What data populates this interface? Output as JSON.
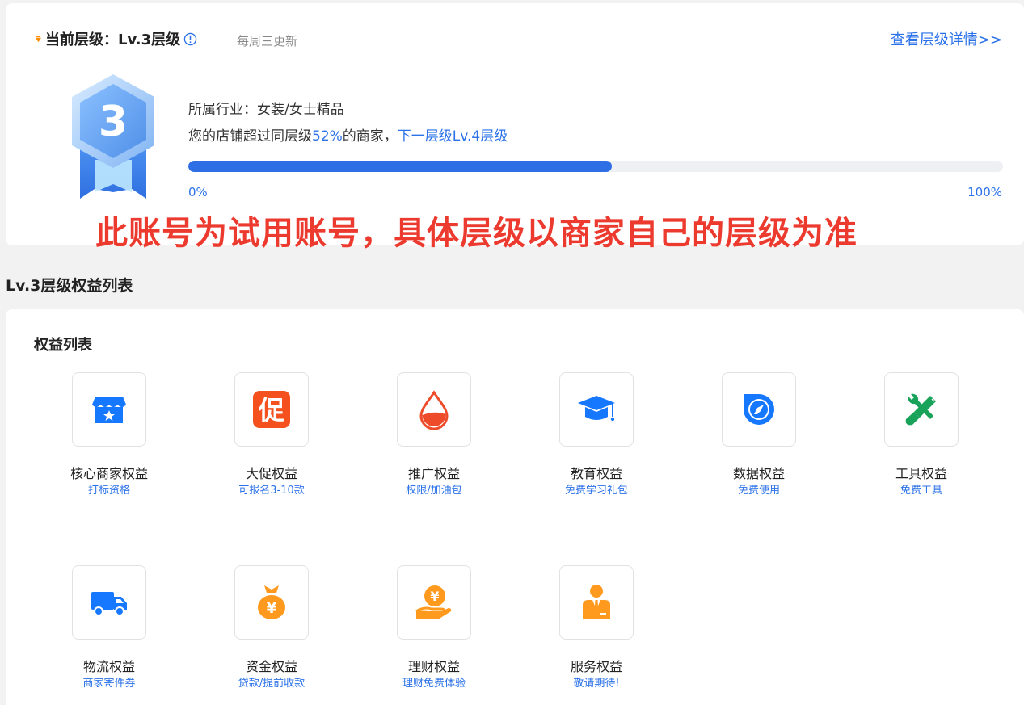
{
  "level": {
    "title": "当前层级：Lv.3层级",
    "update_note": "每周三更新",
    "detail_link": "查看层级详情>>",
    "badge_number": "3",
    "industry": "所属行业：女装/女士精品",
    "exceed_prefix": "您的店铺超过同层级",
    "exceed_percent": "52%",
    "exceed_mid": "的商家，",
    "next_level": "下一层级Lv.4层级",
    "progress_value": 0.52,
    "progress_start": "0%",
    "progress_end": "100%",
    "notice": "此账号为试用账号，具体层级以商家自己的层级为准"
  },
  "section_title": "Lv.3层级权益列表",
  "list_title": "权益列表",
  "benefits": [
    {
      "name": "核心商家权益",
      "sub": "打标资格",
      "icon": "store-icon"
    },
    {
      "name": "大促权益",
      "sub": "可报名3-10款",
      "icon": "promo-icon"
    },
    {
      "name": "推广权益",
      "sub": "权限/加油包",
      "icon": "drop-icon"
    },
    {
      "name": "教育权益",
      "sub": "免费学习礼包",
      "icon": "graduation-cap-icon"
    },
    {
      "name": "数据权益",
      "sub": "免费使用",
      "icon": "compass-icon"
    },
    {
      "name": "工具权益",
      "sub": "免费工具",
      "icon": "tools-icon"
    },
    {
      "name": "物流权益",
      "sub": "商家寄件券",
      "icon": "truck-icon"
    },
    {
      "name": "资金权益",
      "sub": "贷款/提前收款",
      "icon": "money-bag-icon"
    },
    {
      "name": "理财权益",
      "sub": "理财免费体验",
      "icon": "coin-hand-icon"
    },
    {
      "name": "服务权益",
      "sub": "敬请期待!",
      "icon": "service-person-icon"
    }
  ],
  "colors": {
    "accent": "#2b72e8",
    "notice": "#ec3a2f",
    "promo": "#f4511e",
    "tools": "#19a35a",
    "finance": "#ff9a1f"
  }
}
